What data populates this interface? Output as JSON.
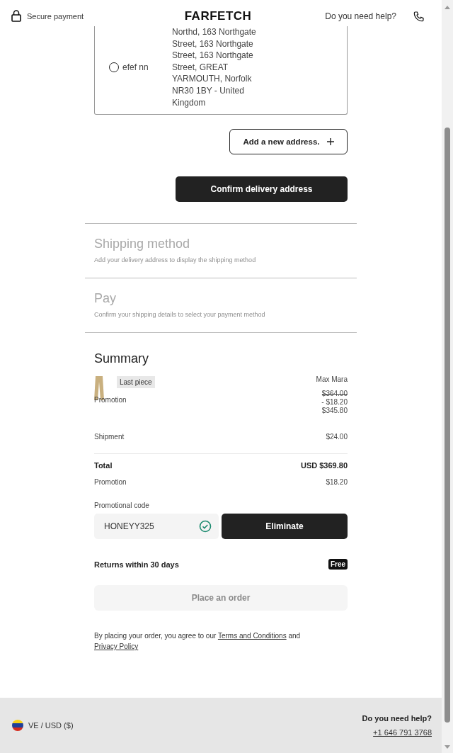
{
  "header": {
    "secure_label": "Secure payment",
    "logo": "FARFETCH",
    "help_label": "Do you need help?"
  },
  "address": {
    "name": "efef nn",
    "selected": false,
    "lines": "Northd, 163 Northgate Street, 163 Northgate Street, 163 Northgate Street, GREAT YARMOUTH, Norfolk NR30 1BY - United Kingdom"
  },
  "add_address_button": "Add a new address.",
  "confirm_button": "Confirm delivery address",
  "steps": [
    {
      "title": "Shipping method",
      "subtitle": "Add your delivery address to display the shipping method",
      "disabled": true
    },
    {
      "title": "Pay",
      "subtitle": "Confirm your shipping details to select your payment method",
      "disabled": true
    }
  ],
  "summary": {
    "title": "Summary",
    "item": {
      "badge": "Last piece",
      "brand": "Max Mara",
      "label": "Promotion",
      "original_price": "$364.00",
      "discount": "- $18.20",
      "price": "$345.80"
    },
    "shipment": {
      "label": "Shipment",
      "value": "$24.00"
    },
    "total": {
      "label": "Total",
      "value": "USD $369.80"
    },
    "promotion": {
      "label": "Promotion",
      "value": "$18.20"
    },
    "promo_code": {
      "label": "Promotional code",
      "value": "HONEYY325",
      "valid": true,
      "button": "Eliminate"
    },
    "returns": {
      "label": "Returns within 30 days",
      "badge": "Free"
    },
    "place_order": {
      "label": "Place an order",
      "disabled": true
    },
    "legal": {
      "before": "By placing your order, you agree to our",
      "terms": "Terms and Conditions",
      "middle": "and",
      "privacy": "Privacy Policy"
    }
  },
  "footer": {
    "locale": "VE / USD ($)",
    "help_title": "Do you need help?",
    "phone": "+1 646 791 3768"
  }
}
